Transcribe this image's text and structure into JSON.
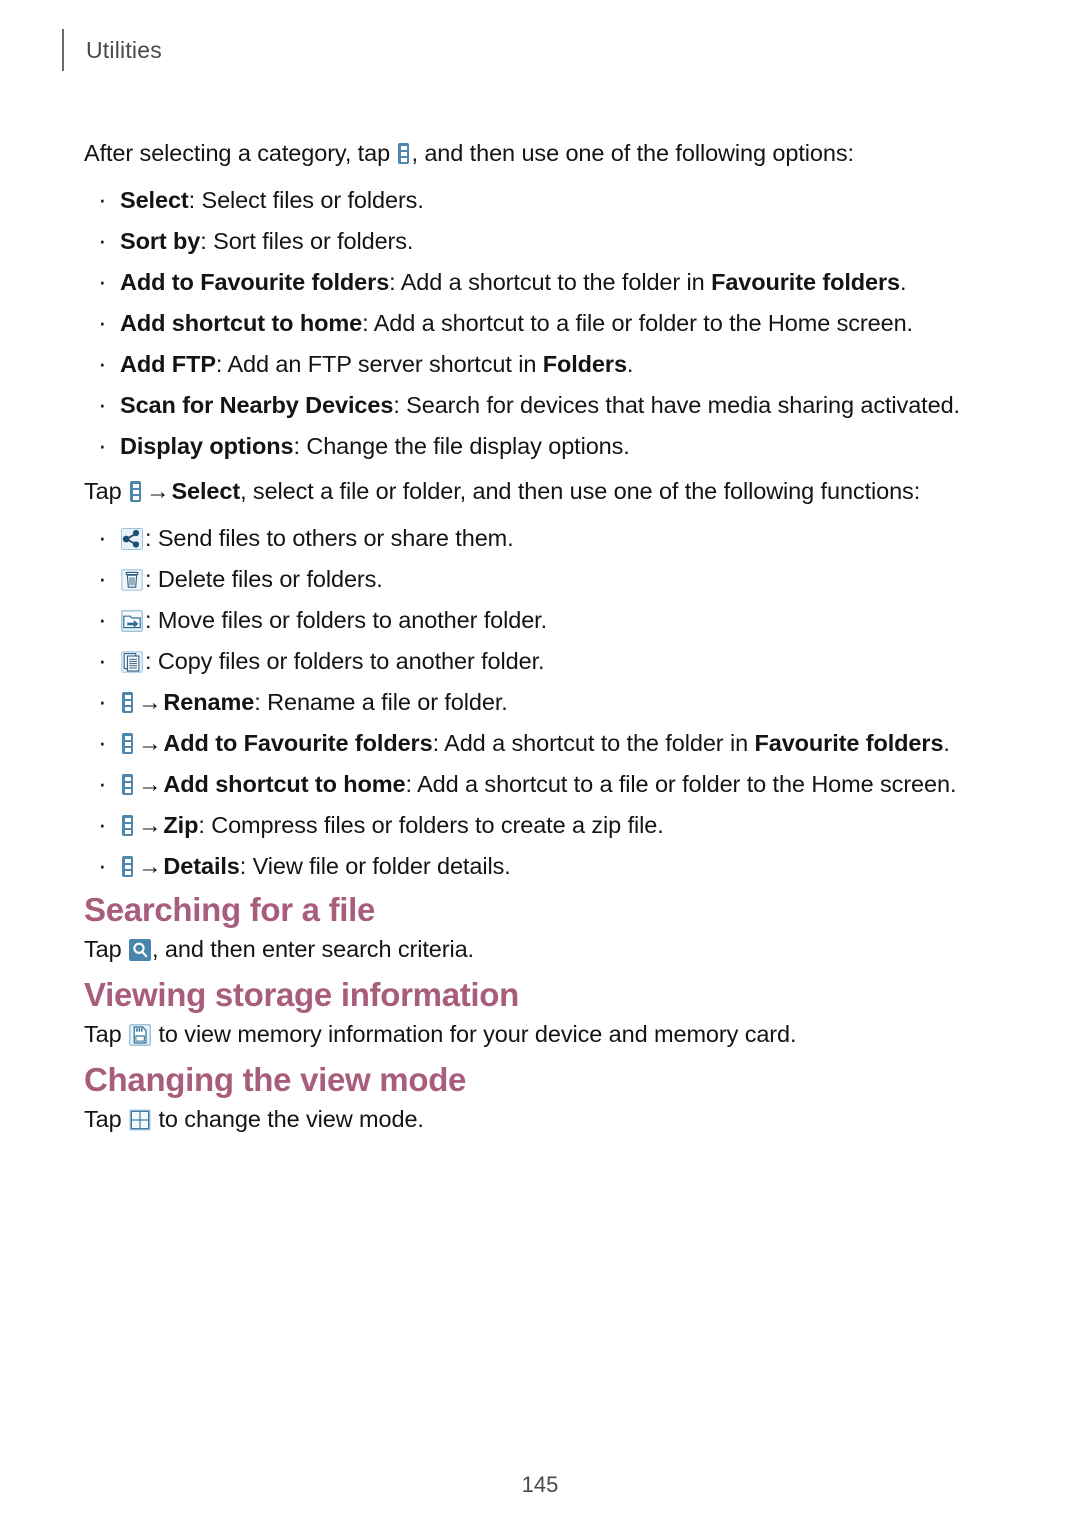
{
  "header": {
    "title": "Utilities"
  },
  "intro": {
    "before_icon": "After selecting a category, tap ",
    "after_icon": ", and then use one of the following options:"
  },
  "options_list": [
    {
      "term": "Select",
      "sep": ": ",
      "desc": "Select files or folders."
    },
    {
      "term": "Sort by",
      "sep": ": ",
      "desc": "Sort files or folders."
    },
    {
      "term": "Add to Favourite folders",
      "sep": ": ",
      "desc": "Add a shortcut to the folder in ",
      "desc_bold": "Favourite folders",
      "desc_tail": "."
    },
    {
      "term": "Add shortcut to home",
      "sep": ": ",
      "desc": "Add a shortcut to a file or folder to the Home screen."
    },
    {
      "term": "Add FTP",
      "sep": ": ",
      "desc": "Add an FTP server shortcut in ",
      "desc_bold": "Folders",
      "desc_tail": "."
    },
    {
      "term": "Scan for Nearby Devices",
      "sep": ": ",
      "desc": "Search for devices that have media sharing activated."
    },
    {
      "term": "Display options",
      "sep": ": ",
      "desc": "Change the file display options."
    }
  ],
  "functions_intro": {
    "tap": "Tap ",
    "arrow": "→",
    "bold": "Select",
    "rest": ", select a file or folder, and then use one of the following functions:"
  },
  "functions_list": [
    {
      "icon": "share-icon",
      "lead": "",
      "sep": ": ",
      "desc": "Send files to others or share them."
    },
    {
      "icon": "trash-icon",
      "lead": "",
      "sep": ": ",
      "desc": "Delete files or folders."
    },
    {
      "icon": "move-icon",
      "lead": "",
      "sep": ": ",
      "desc": "Move files or folders to another folder."
    },
    {
      "icon": "copy-icon",
      "lead": "",
      "sep": ": ",
      "desc": "Copy files or folders to another folder."
    },
    {
      "icon": "more-options-icon",
      "arrow": "→",
      "term": "Rename",
      "sep": ": ",
      "desc": "Rename a file or folder."
    },
    {
      "icon": "more-options-icon",
      "arrow": "→",
      "term": "Add to Favourite folders",
      "sep": ": ",
      "desc": "Add a shortcut to the folder in ",
      "desc_bold": "Favourite folders",
      "desc_tail": "."
    },
    {
      "icon": "more-options-icon",
      "arrow": "→",
      "term": "Add shortcut to home",
      "sep": ": ",
      "desc": "Add a shortcut to a file or folder to the Home screen."
    },
    {
      "icon": "more-options-icon",
      "arrow": "→",
      "term": "Zip",
      "sep": ": ",
      "desc": "Compress files or folders to create a zip file."
    },
    {
      "icon": "more-options-icon",
      "arrow": "→",
      "term": "Details",
      "sep": ": ",
      "desc": "View file or folder details."
    }
  ],
  "sections": [
    {
      "heading": "Searching for a file",
      "body_before": "Tap ",
      "icon": "search-icon",
      "body_after": ", and then enter search criteria."
    },
    {
      "heading": "Viewing storage information",
      "body_before": "Tap ",
      "icon": "storage-card-icon",
      "body_after": " to view memory information for your device and memory card."
    },
    {
      "heading": "Changing the view mode",
      "body_before": "Tap ",
      "icon": "grid-view-icon",
      "body_after": " to change the view mode."
    }
  ],
  "footer": {
    "page_number": "145"
  },
  "colors": {
    "heading": "#a75d7b",
    "icon_blue": "#4f86ae",
    "icon_blue_dark": "#2f6f96",
    "text": "#141414",
    "header_text": "#4a4a4a"
  }
}
